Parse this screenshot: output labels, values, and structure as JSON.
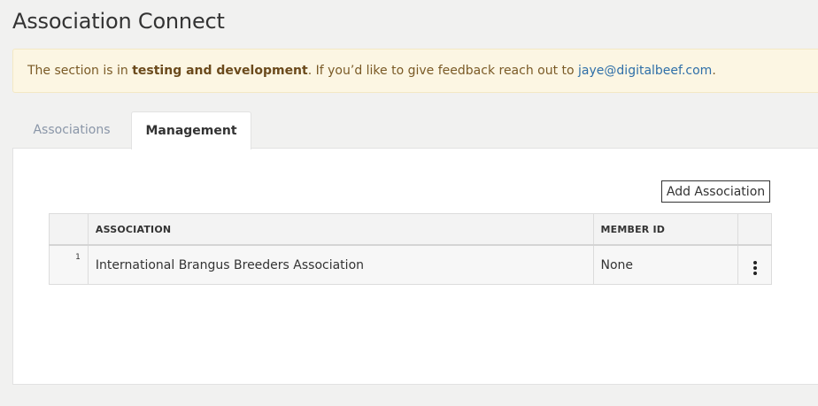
{
  "page": {
    "title": "Association Connect"
  },
  "notice": {
    "prefix": "The section is in ",
    "bold": "testing and development",
    "middle": ". If you’d like to give feedback reach out to ",
    "email": "jaye@digitalbeef.com",
    "suffix": "."
  },
  "tabs": [
    {
      "label": "Associations",
      "active": false
    },
    {
      "label": "Management",
      "active": true
    }
  ],
  "toolbar": {
    "add_label": "Add Association"
  },
  "table": {
    "columns": [
      "",
      "ASSOCIATION",
      "MEMBER ID",
      ""
    ],
    "rows": [
      {
        "num": "1",
        "association": "International Brangus Breeders Association",
        "member_id": "None",
        "action_icon": "more-vertical-icon"
      }
    ]
  }
}
